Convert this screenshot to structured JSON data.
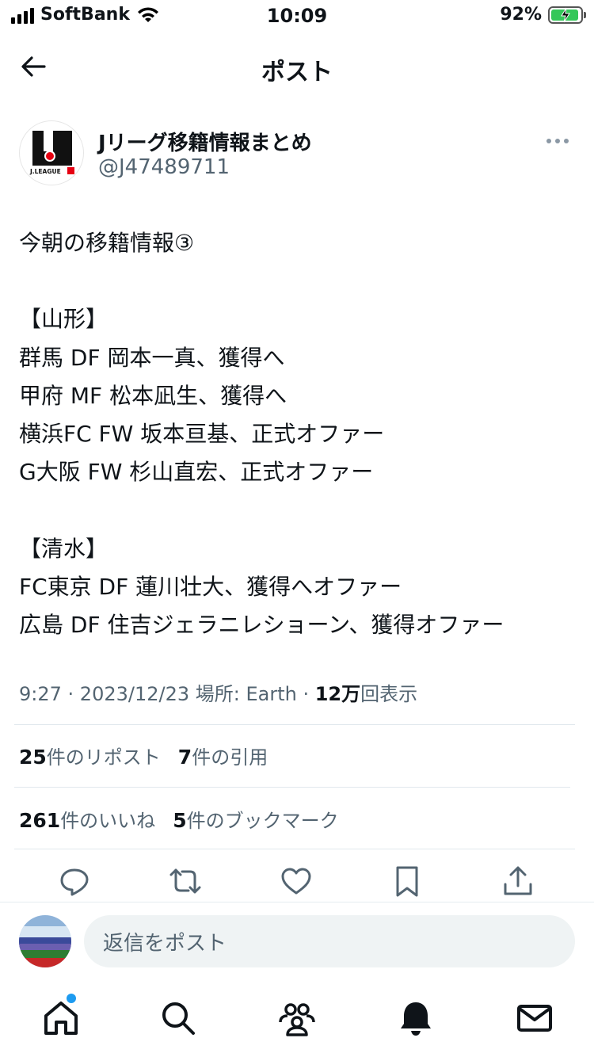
{
  "status_bar": {
    "carrier": "SoftBank",
    "time": "10:09",
    "battery_percent": "92%",
    "battery_level": 0.92,
    "battery_color": "#34c759",
    "icons": [
      "signal-icon",
      "wifi-icon",
      "battery-charging-icon"
    ]
  },
  "header": {
    "title": "ポスト",
    "back_icon": "arrow-left-icon"
  },
  "author": {
    "name": "Jリーグ移籍情報まとめ",
    "handle": "@J47489711",
    "avatar_text": "J.LEAGUE"
  },
  "post": {
    "lines": [
      "今朝の移籍情報③",
      "",
      "【山形】",
      "群馬 DF 岡本一真、獲得へ",
      "甲府 MF 松本凪生、獲得へ",
      "横浜FC FW 坂本亘基、正式オファー",
      "G大阪 FW 杉山直宏、正式オファー",
      "",
      "【清水】",
      "FC東京 DF 蓮川壮大、獲得へオファー",
      "広島 DF 住吉ジェラニレショーン、獲得オファー"
    ],
    "meta": {
      "time": "9:27",
      "sep1": " · ",
      "date": "2023/12/23",
      "location_label": "場所: Earth",
      "sep2": " · ",
      "views_count": "12万",
      "views_label": "回表示"
    }
  },
  "stats": {
    "reposts_count": "25",
    "reposts_label": "件のリポスト",
    "quotes_count": "7",
    "quotes_label": "件の引用",
    "likes_count": "261",
    "likes_label": "件のいいね",
    "bookmarks_count": "5",
    "bookmarks_label": "件のブックマーク"
  },
  "actions": [
    "reply-icon",
    "repost-icon",
    "like-icon",
    "bookmark-icon",
    "share-icon"
  ],
  "reply_bar": {
    "placeholder": "返信をポスト"
  },
  "tabbar": {
    "items": [
      "home-icon",
      "search-icon",
      "communities-icon",
      "notifications-icon",
      "messages-icon"
    ],
    "accent": "#1d9bf0"
  }
}
